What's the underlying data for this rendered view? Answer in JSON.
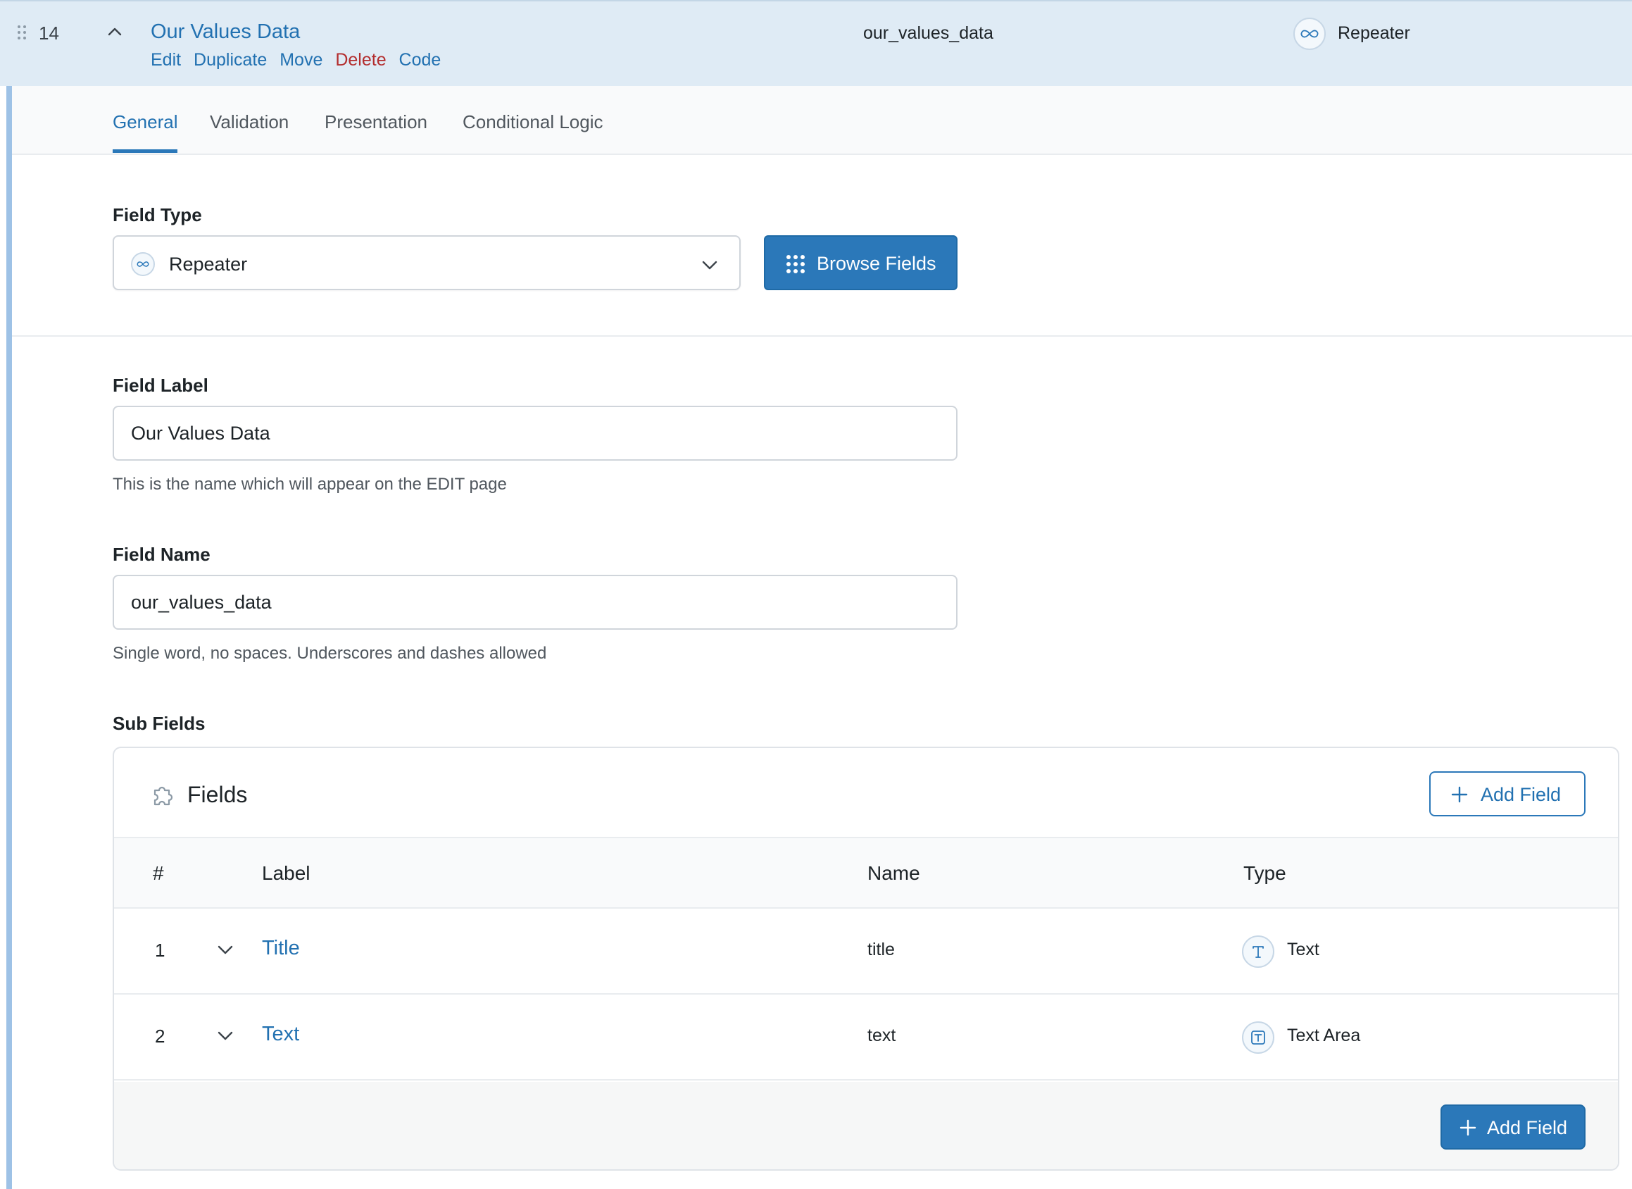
{
  "header": {
    "order": "14",
    "title": "Our Values Data",
    "actions": {
      "edit": "Edit",
      "duplicate": "Duplicate",
      "move": "Move",
      "delete": "Delete",
      "code": "Code"
    },
    "field_name": "our_values_data",
    "field_type": "Repeater",
    "field_type_icon": "repeater-infinity-icon"
  },
  "tabs": [
    {
      "label": "General",
      "active": true
    },
    {
      "label": "Validation",
      "active": false
    },
    {
      "label": "Presentation",
      "active": false
    },
    {
      "label": "Conditional Logic",
      "active": false
    }
  ],
  "field_type": {
    "label": "Field Type",
    "selected": "Repeater",
    "browse_button": "Browse Fields"
  },
  "field_label": {
    "label": "Field Label",
    "value": "Our Values Data",
    "instructions": "This is the name which will appear on the EDIT page"
  },
  "field_name": {
    "label": "Field Name",
    "value": "our_values_data",
    "instructions": "Single word, no spaces. Underscores and dashes allowed"
  },
  "sub_fields": {
    "label": "Sub Fields",
    "panel_title": "Fields",
    "add_field_label": "Add Field",
    "columns": {
      "order": "#",
      "label": "Label",
      "name": "Name",
      "type": "Type"
    },
    "rows": [
      {
        "order": "1",
        "label": "Title",
        "name": "title",
        "type": "Text",
        "type_icon": "text-icon"
      },
      {
        "order": "2",
        "label": "Text",
        "name": "text",
        "type": "Text Area",
        "type_icon": "textarea-icon"
      }
    ]
  },
  "colors": {
    "primary": "#2b78b9",
    "link": "#2271b1",
    "delete": "#b32d2e",
    "header_bg": "#dfebf5"
  }
}
